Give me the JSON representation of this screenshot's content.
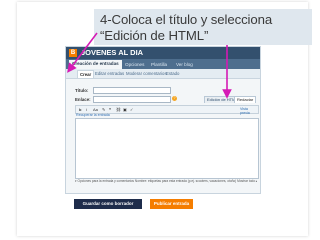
{
  "caption": {
    "line1": "4-Coloca el título y selecciona",
    "line2": "“Edición de HTML”"
  },
  "blog": {
    "logo": "B",
    "name": "JOVENES AL DIA"
  },
  "main_tabs": [
    "Creación de entradas",
    "Opciones",
    "Plantilla",
    "Ver blog"
  ],
  "sub_tabs": [
    "Crear",
    "Editar entradas",
    "Moderar comentarios",
    "Estado"
  ],
  "form": {
    "title_label": "Título:",
    "link_label": "Enlace:",
    "mode_html": "Edición de HTML",
    "mode_compose": "Redactar",
    "tools": [
      "b",
      "i",
      "Aa",
      "✎",
      "❝",
      "⛓",
      "▣",
      "✓"
    ],
    "preview_link": "Vista previa",
    "recover_link": "Recuperar la entrada"
  },
  "status": {
    "text": "▾ Opciones para la entrada y comentarios     Nombre: etiquetas para esta entrada (p.ej. scooters, vacaciones, otoño)     Mostrar todo  ▸ Añadir  ▸ Publicar  ▸ 0"
  },
  "buttons": {
    "save_draft": "Guardar como borrador",
    "publish": "Publicar entrada"
  },
  "colors": {
    "accent": "#f57d00",
    "arrow": "#d51ab5",
    "header": "#33506e"
  }
}
